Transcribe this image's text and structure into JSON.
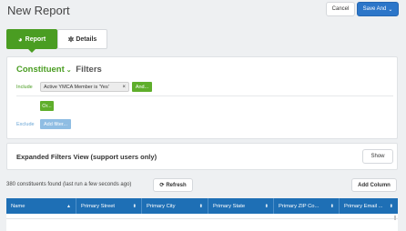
{
  "header": {
    "title": "New Report",
    "cancel_label": "Cancel",
    "save_label": "Save And",
    "save_caret": "⌄"
  },
  "tabs": [
    {
      "label": "Report",
      "icon": "pie-chart-icon",
      "active": true
    },
    {
      "label": "Details",
      "icon": "gear-icon",
      "active": false
    }
  ],
  "filters": {
    "entity": "Constituent",
    "title": "Filters",
    "include_label": "Include",
    "exclude_label": "Exclude",
    "chip_text": "Active YMCA Member is 'Yes'",
    "chip_remove": "×",
    "and_label": "And...",
    "or_label": "Or...",
    "add_filter_label": "Add filter..."
  },
  "expanded": {
    "title": "Expanded Filters View (support users only)",
    "show_label": "Show"
  },
  "results": {
    "found_text": "380 constituents found (last run a few seconds ago)",
    "refresh_label": "Refresh",
    "add_column_label": "Add Column"
  },
  "table": {
    "columns": [
      {
        "label": "Name",
        "sort": "▲"
      },
      {
        "label": "Primary Street",
        "sort": "⬍"
      },
      {
        "label": "Primary City",
        "sort": "⬍"
      },
      {
        "label": "Primary State",
        "sort": "⬍"
      },
      {
        "label": "Primary ZIP Co...",
        "sort": "⬍"
      },
      {
        "label": "Primary Email ...",
        "sort": "⬍"
      }
    ]
  },
  "colors": {
    "accent_green": "#4a9d22",
    "save_blue": "#2c76c9",
    "table_header_blue": "#1e6fb5"
  }
}
